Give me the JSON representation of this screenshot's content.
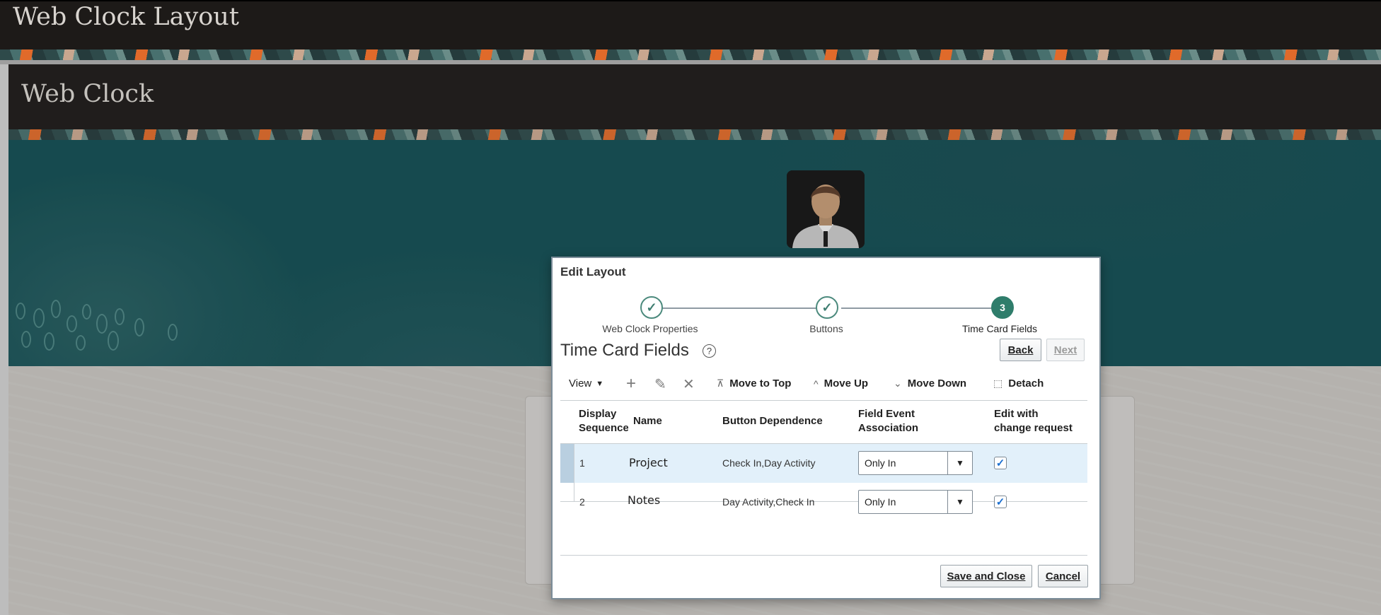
{
  "outer": {
    "title": "Web Clock Layout"
  },
  "inner": {
    "title": "Web Clock"
  },
  "dialog": {
    "title": "Edit Layout",
    "train": {
      "steps": [
        {
          "label": "Web Clock Properties",
          "state": "complete"
        },
        {
          "label": "Buttons",
          "state": "complete"
        },
        {
          "label": "Time Card Fields",
          "state": "current",
          "number": "3"
        }
      ]
    },
    "section_title": "Time Card Fields",
    "help_icon": "?",
    "back_label": "Back",
    "next_label": "Next",
    "toolbar": {
      "view_label": "View",
      "view_arrow": "▼",
      "add_icon": "+",
      "edit_icon": "✎",
      "delete_icon": "✕",
      "move_top_glyph": "⊼",
      "move_top_label": "Move to Top",
      "move_up_glyph": "^",
      "move_up_label": "Move Up",
      "move_down_glyph": "⌄",
      "move_down_label": "Move Down",
      "detach_glyph": "⬚",
      "detach_label": "Detach"
    },
    "table": {
      "headers": {
        "display_seq_1": "Display",
        "display_seq_2": "Sequence",
        "name": "Name",
        "button_dependence": "Button Dependence",
        "field_event_1": "Field Event",
        "field_event_2": "Association",
        "edit_change_1": "Edit with",
        "edit_change_2": "change request"
      },
      "rows": [
        {
          "seq": "1",
          "name": "Project",
          "dependence": "Check In,Day Activity",
          "association": "Only In",
          "edit_with_change": true
        },
        {
          "seq": "2",
          "name": "Notes",
          "dependence": "Day Activity,Check In",
          "association": "Only In",
          "edit_with_change": true
        }
      ]
    },
    "select_arrow": "▼",
    "check_mark": "✓",
    "save_close_label": "Save and Close",
    "cancel_label": "Cancel"
  },
  "colors": {
    "title_bar": "#1d1a18",
    "hero_teal": "#124d52",
    "train_green": "#2f7d6b",
    "selected_row": "#e2f0fa",
    "selected_strip": "#b9cfe0"
  }
}
